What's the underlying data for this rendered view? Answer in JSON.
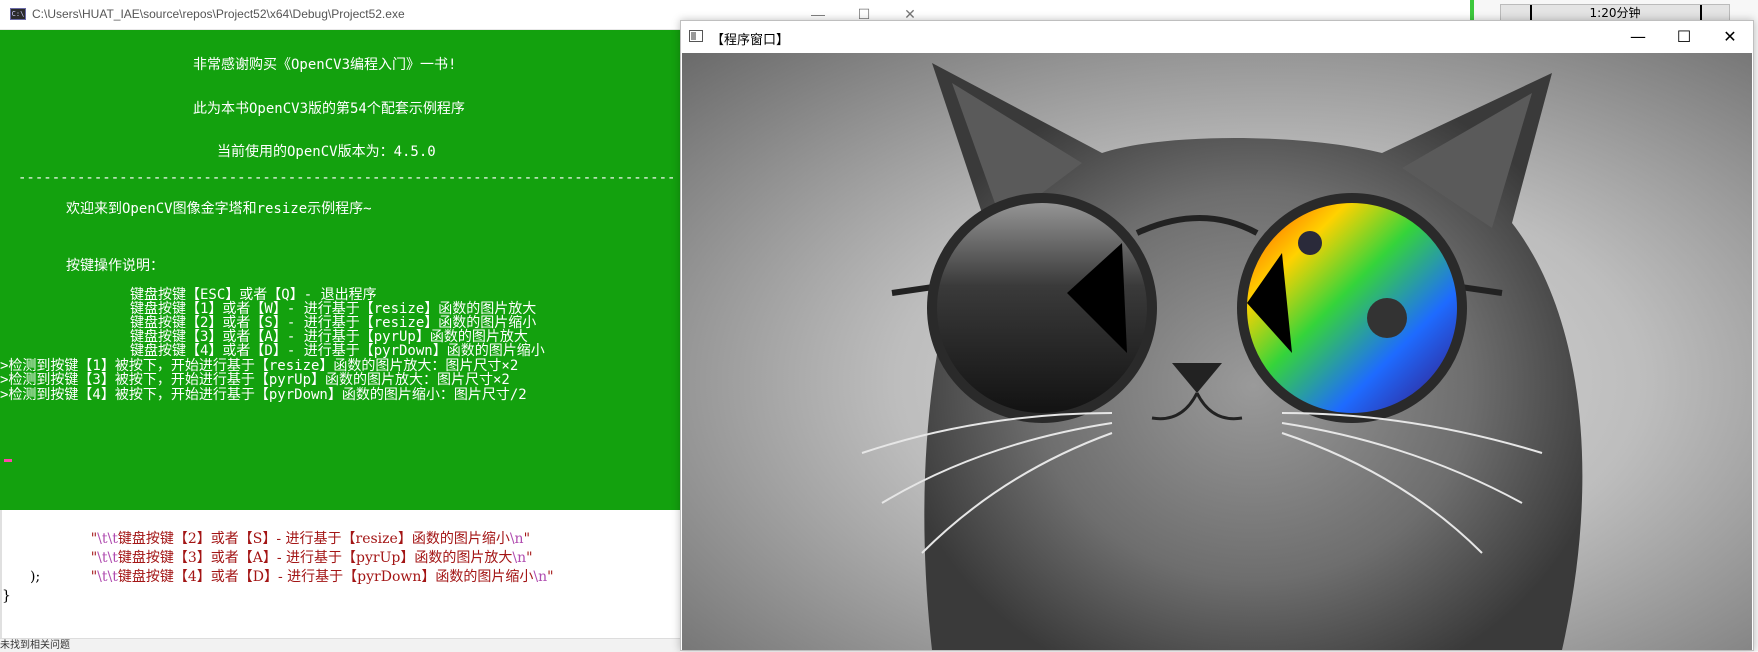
{
  "console_window": {
    "title": "C:\\Users\\HUAT_IAE\\source\\repos\\Project52\\x64\\Debug\\Project52.exe",
    "icon": "console-icon",
    "lines": [
      "非常感谢购买《OpenCV3编程入门》一书!",
      "此为本书OpenCV3版的第54个配套示例程序",
      "当前使用的OpenCV版本为：4.5.0",
      "------------------------------------------------------------------------------",
      "欢迎来到OpenCV图像金字塔和resize示例程序~",
      "按键操作说明：",
      "键盘按键【ESC】或者【Q】- 退出程序",
      "键盘按键【1】或者【W】- 进行基于【resize】函数的图片放大",
      "键盘按键【2】或者【S】- 进行基于【resize】函数的图片缩小",
      "键盘按键【3】或者【A】- 进行基于【pyrUp】函数的图片放大",
      "键盘按键【4】或者【D】- 进行基于【pyrDown】函数的图片缩小",
      ">检测到按键【1】被按下，开始进行基于【resize】函数的图片放大：图片尺寸×2",
      ">检测到按键【3】被按下，开始进行基于【pyrUp】函数的图片放大：图片尺寸×2",
      ">检测到按键【4】被按下，开始进行基于【pyrDown】函数的图片缩小：图片尺寸/2"
    ],
    "background_color": "#13a10e"
  },
  "code_editor": {
    "lines": [
      {
        "pre": "\"",
        "esc": "\\t\\t",
        "text": "键盘按键【2】或者【S】- 进行基于【resize】函数的图片缩小",
        "esc2": "\\n",
        "post": "\""
      },
      {
        "pre": "\"",
        "esc": "\\t\\t",
        "text": "键盘按键【3】或者【A】- 进行基于【pyrUp】函数的图片放大",
        "esc2": "\\n",
        "post": "\""
      },
      {
        "pre": "\"",
        "esc": "\\t\\t",
        "text": "键盘按键【4】或者【D】- 进行基于【pyrDown】函数的图片缩小",
        "esc2": "\\n",
        "post": "\""
      }
    ],
    "close_paren": ");",
    "close_brace": "}",
    "status_text": "未找到相关问题"
  },
  "background_app": {
    "time_label": "1:20分钟"
  },
  "image_window": {
    "title": "【程序窗口】",
    "minimize": "—",
    "maximize": "☐",
    "close": "✕"
  }
}
